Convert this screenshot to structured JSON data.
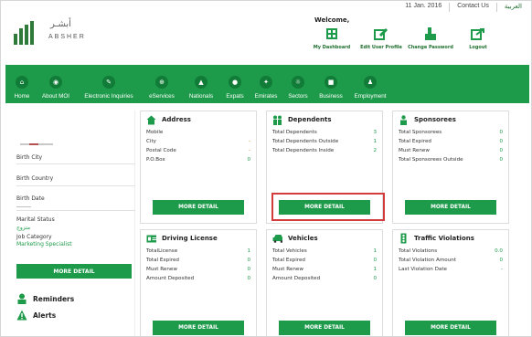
{
  "header": {
    "logo_arabic": "أبشـر",
    "logo_english": "ABSHER",
    "date": "11 Jan. 2016",
    "contact": "Contact Us",
    "language": "العربية",
    "welcome": "Welcome,"
  },
  "quick_links": [
    {
      "label": "My Dashboard",
      "icon": "dashboard-icon"
    },
    {
      "label": "Edit User Profile",
      "icon": "edit-profile-icon"
    },
    {
      "label": "Change Password",
      "icon": "change-password-icon"
    },
    {
      "label": "Logout",
      "icon": "logout-icon"
    }
  ],
  "nav": [
    {
      "label": "Home",
      "icon": "home-icon"
    },
    {
      "label": "About MOI",
      "icon": "about-icon"
    },
    {
      "label": "Electronic Inquiries",
      "icon": "inquiries-icon"
    },
    {
      "label": "eServices",
      "icon": "eservices-icon"
    },
    {
      "label": "Nationals",
      "icon": "nationals-icon"
    },
    {
      "label": "Expats",
      "icon": "expats-icon"
    },
    {
      "label": "Emirates",
      "icon": "emirates-icon"
    },
    {
      "label": "Sectors",
      "icon": "sectors-icon"
    },
    {
      "label": "Business",
      "icon": "business-icon"
    },
    {
      "label": "Employment",
      "icon": "employment-icon"
    }
  ],
  "sidebar": {
    "birth_city": "Birth City",
    "birth_country": "Birth Country",
    "birth_date": "Birth Date",
    "birth_date_value": "ـــــــــ",
    "marital_status": "Marital Status",
    "marital_value": "متزوج",
    "job_category": "Job Category",
    "job_value": "Marketing Specialist",
    "more_detail": "MORE DETAIL",
    "reminders": "Reminders",
    "alerts": "Alerts"
  },
  "cards": {
    "address": {
      "title": "Address",
      "rows": [
        {
          "label": "Mobile",
          "value": ""
        },
        {
          "label": "City",
          "value": "-"
        },
        {
          "label": "Postal Code",
          "value": "-"
        },
        {
          "label": "P.O.Box",
          "value": "0"
        }
      ],
      "button": "MORE DETAIL"
    },
    "dependents": {
      "title": "Dependents",
      "rows": [
        {
          "label": "Total Dependents",
          "value": "3"
        },
        {
          "label": "Total Dependents Outside",
          "value": "1"
        },
        {
          "label": "Total Dependents Inside",
          "value": "2"
        }
      ],
      "button": "MORE DETAIL"
    },
    "sponsorees": {
      "title": "Sponsorees",
      "rows": [
        {
          "label": "Total Sponsorees",
          "value": "0"
        },
        {
          "label": "Total Expired",
          "value": "0"
        },
        {
          "label": "Must Renew",
          "value": "0"
        },
        {
          "label": "Total Sponsorees Outside",
          "value": "0"
        }
      ],
      "button": "MORE DETAIL"
    },
    "driving": {
      "title": "Driving License",
      "rows": [
        {
          "label": "TotalLicense",
          "value": "1"
        },
        {
          "label": "Total Expired",
          "value": "0"
        },
        {
          "label": "Must Renew",
          "value": "0"
        },
        {
          "label": "Amount Deposited",
          "value": "0"
        }
      ],
      "button": "MORE DETAIL"
    },
    "vehicles": {
      "title": "Vehicles",
      "rows": [
        {
          "label": "Total Vehicles",
          "value": "1"
        },
        {
          "label": "Total Expired",
          "value": "0"
        },
        {
          "label": "Must Renew",
          "value": "1"
        },
        {
          "label": "Amount Deposited",
          "value": "0"
        }
      ],
      "button": "MORE DETAIL"
    },
    "traffic": {
      "title": "Traffic Violations",
      "rows": [
        {
          "label": "Total Violations",
          "value": "0.0"
        },
        {
          "label": "Total Violation Amount",
          "value": "0"
        },
        {
          "label": "Last Violation Date",
          "value": "-"
        }
      ],
      "button": "MORE DETAIL"
    }
  },
  "colors": {
    "brand_green": "#1d9a4a",
    "dark_green": "#117c37",
    "highlight": "#d23c3c"
  }
}
